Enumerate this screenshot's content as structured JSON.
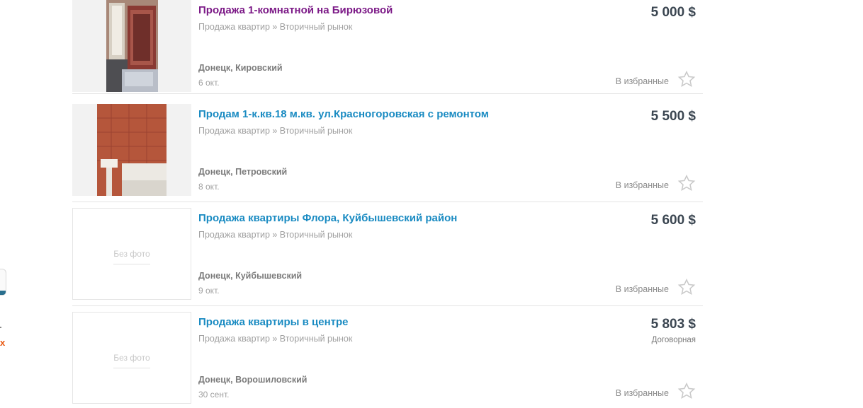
{
  "sidebar_fragment": {
    "visible_text": "х"
  },
  "listings": [
    {
      "title": "Продажа 1-комнатной на Бирюзовой",
      "visited": true,
      "category": "Продажа квартир » Вторичный рынок",
      "location": "Донецк, Кировский",
      "date": "6 окт.",
      "price": "5 000 $",
      "negotiable": "",
      "favorite_label": "В избранные",
      "photo": "room-photo"
    },
    {
      "title": "Продам 1-к.кв.18 м.кв. ул.Красногоровская с ремонтом",
      "visited": false,
      "category": "Продажа квартир » Вторичный рынок",
      "location": "Донецк, Петровский",
      "date": "8 окт.",
      "price": "5 500 $",
      "negotiable": "",
      "favorite_label": "В избранные",
      "photo": "bathroom-photo"
    },
    {
      "title": "Продажа квартиры Флора, Куйбышевский район",
      "visited": false,
      "category": "Продажа квартир » Вторичный рынок",
      "location": "Донецк, Куйбышевский",
      "date": "9 окт.",
      "price": "5 600 $",
      "negotiable": "",
      "favorite_label": "В избранные",
      "photo": "none",
      "no_photo_label": "Без фото"
    },
    {
      "title": "Продажа квартиры в центре",
      "visited": false,
      "category": "Продажа квартир » Вторичный рынок",
      "location": "Донецк, Ворошиловский",
      "date": "30 сент.",
      "price": "5 803 $",
      "negotiable": "Договорная",
      "favorite_label": "В избранные",
      "photo": "none",
      "no_photo_label": "Без фото"
    }
  ],
  "colors": {
    "title_link": "#1a8bc2",
    "title_visited": "#7c1a87",
    "price": "#3b4651",
    "accent_orange": "#e8550c"
  }
}
